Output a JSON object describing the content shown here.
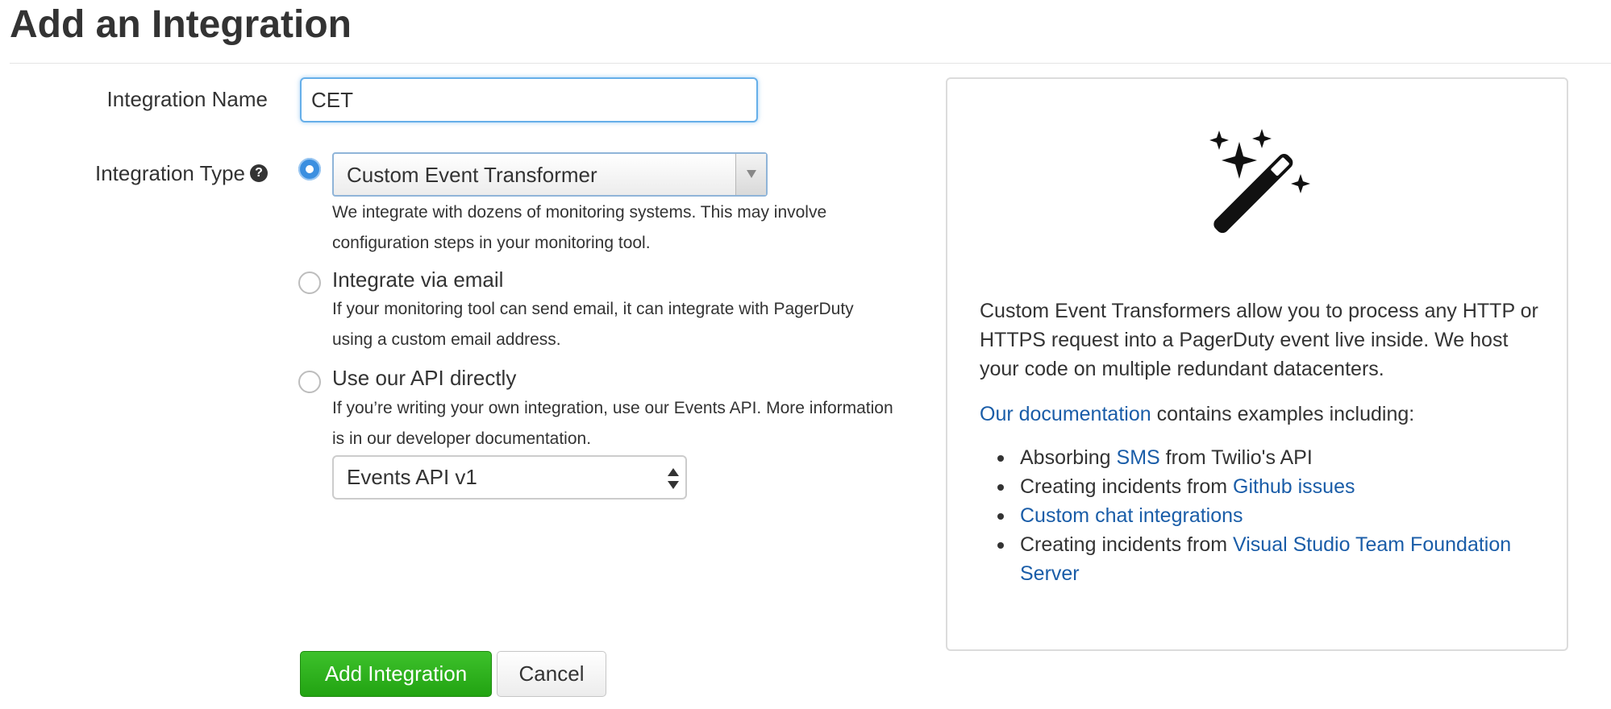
{
  "page": {
    "title": "Add an Integration"
  },
  "form": {
    "name_label": "Integration Name",
    "name_value": "CET",
    "type_label": "Integration Type",
    "help_glyph": "?",
    "options": [
      {
        "id": "cet",
        "selected": true,
        "combo_value": "Custom Event Transformer",
        "description": "We integrate with dozens of monitoring systems. This may involve configuration steps in your monitoring tool."
      },
      {
        "id": "email",
        "selected": false,
        "title": "Integrate via email",
        "description": "If your monitoring tool can send email, it can integrate with PagerDuty using a custom email address."
      },
      {
        "id": "api",
        "selected": false,
        "title": "Use our API directly",
        "description": "If you’re writing your own integration, use our Events API. More information is in our developer documentation.",
        "select_value": "Events API v1"
      }
    ],
    "submit_label": "Add Integration",
    "cancel_label": "Cancel"
  },
  "panel": {
    "icon": "magic-wand-icon",
    "description": "Custom Event Transformers allow you to process any HTTP or HTTPS request into a PagerDuty event live inside. We host your code on multiple redundant datacenters.",
    "docs_link": "Our documentation",
    "docs_suffix": " contains examples including:",
    "items": [
      {
        "prefix": "Absorbing ",
        "link": "SMS",
        "suffix": " from Twilio's API"
      },
      {
        "prefix": "Creating incidents from ",
        "link": "Github issues",
        "suffix": ""
      },
      {
        "prefix": "",
        "link": "Custom chat integrations",
        "suffix": ""
      },
      {
        "prefix": "Creating incidents from ",
        "link": "Visual Studio Team Foundation Server",
        "suffix": ""
      }
    ]
  },
  "colors": {
    "primary_green": "#22a312",
    "link_blue": "#1a5da8",
    "focus_blue": "#66afe9",
    "radio_blue": "#3b8fe0"
  }
}
